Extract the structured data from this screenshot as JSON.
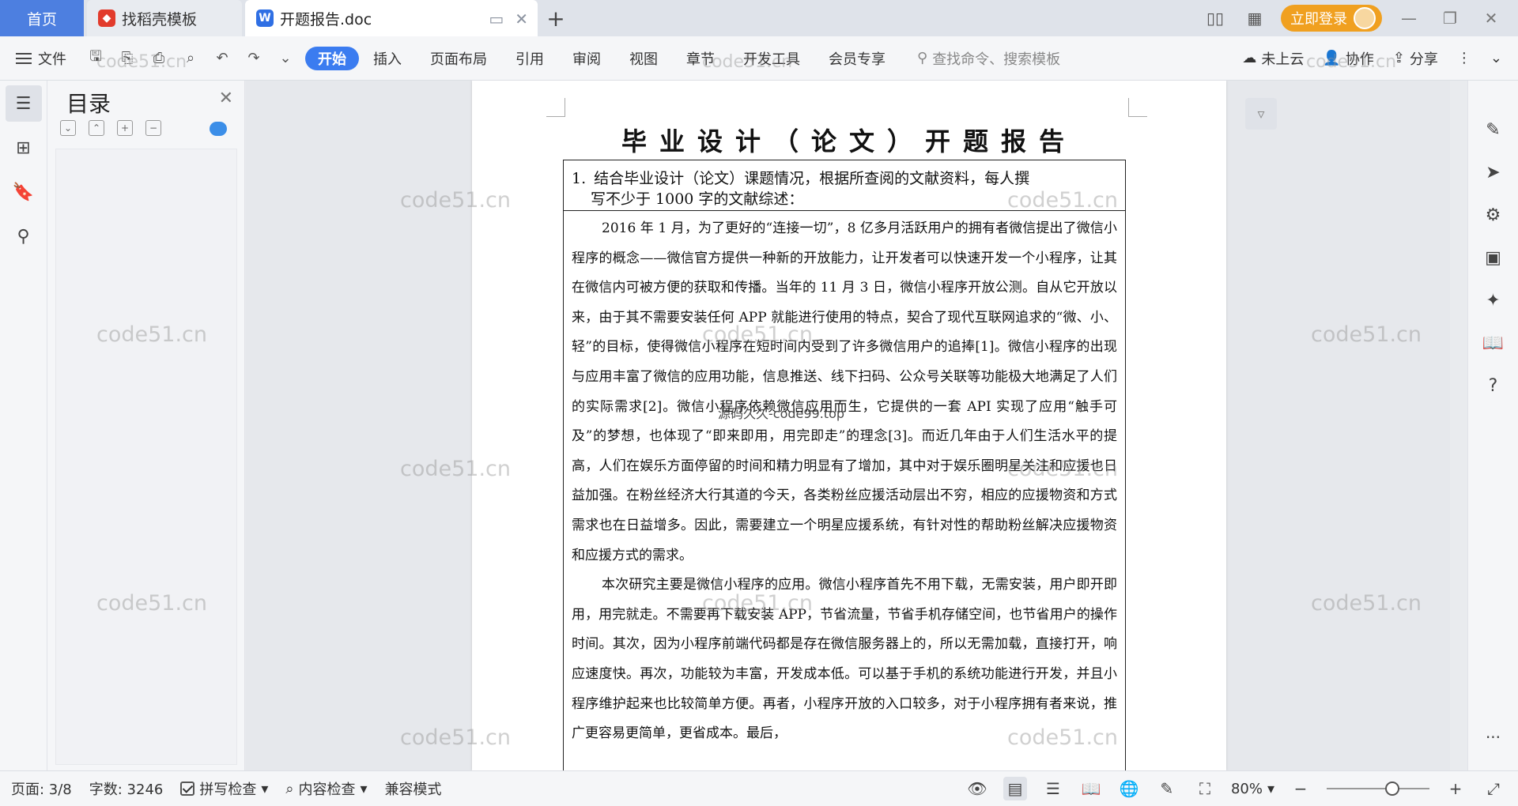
{
  "tabs": {
    "home": "首页",
    "template": "找稻壳模板",
    "document": "开题报告.doc"
  },
  "topbar": {
    "login_label": "立即登录"
  },
  "ribbon": {
    "file_label": "文件",
    "tabs": [
      "开始",
      "插入",
      "页面布局",
      "引用",
      "审阅",
      "视图",
      "章节",
      "开发工具",
      "会员专享"
    ],
    "active_tab": "开始",
    "search_placeholder": "查找命令、搜索模板",
    "cloud_label": "未上云",
    "collab_label": "协作",
    "share_label": "分享"
  },
  "toc": {
    "title": "目录"
  },
  "document": {
    "title": "毕业设计（论文）开题报告",
    "table_heading_num": "1.",
    "table_heading_line1": "结合毕业设计（论文）课题情况，根据所查阅的文献资料，每人撰",
    "table_heading_line2": "写不少于 1000 字的文献综述：",
    "para1": "2016 年 1 月，为了更好的“连接一切”，8 亿多月活跃用户的拥有者微信提出了微信小程序的概念——微信官方提供一种新的开放能力，让开发者可以快速开发一个小程序，让其在微信内可被方便的获取和传播。当年的 11 月 3 日，微信小程序开放公测。自从它开放以来，由于其不需要安装任何 APP 就能进行使用的特点，契合了现代互联网追求的“微、小、轻”的目标，使得微信小程序在短时间内受到了许多微信用户的追捧[1]。微信小程序的出现与应用丰富了微信的应用功能，信息推送、线下扫码、公众号关联等功能极大地满足了人们的实际需求[2]。微信小程序依赖微信应用而生，它提供的一套 API 实现了应用“触手可及”的梦想，也体现了“即来即用，用完即走”的理念[3]。而近几年由于人们生活水平的提高，人们在娱乐方面停留的时间和精力明显有了增加，其中对于娱乐圈明星关注和应援也日益加强。在粉丝经济大行其道的今天，各类粉丝应援活动层出不穷，相应的应援物资和方式需求也在日益增多。因此，需要建立一个明星应援系统，有针对性的帮助粉丝解决应援物资和应援方式的需求。",
    "para2": "本次研究主要是微信小程序的应用。微信小程序首先不用下载，无需安装，用户即开即用，用完就走。不需要再下载安装 APP，节省流量，节省手机存储空间，也节省用户的操作时间。其次，因为小程序前端代码都是存在微信服务器上的，所以无需加载，直接打开，响应速度快。再次，功能较为丰富，开发成本低。可以基于手机的系统功能进行开发，并且小程序维护起来也比较简单方便。再者，小程序开放的入口较多，对于小程序拥有者来说，推广更容易更简单，更省成本。最后，"
  },
  "watermarks": {
    "site": "code51.cn",
    "source": "源码久久-code99.top"
  },
  "statusbar": {
    "page": "页面: 3/8",
    "words": "字数: 3246",
    "spell": "拼写检查",
    "content_check": "内容检查",
    "compat": "兼容模式",
    "zoom": "80%"
  },
  "colors": {
    "accent": "#3b7cf0",
    "home_tab": "#4d7fe0",
    "login": "#f0a020"
  }
}
